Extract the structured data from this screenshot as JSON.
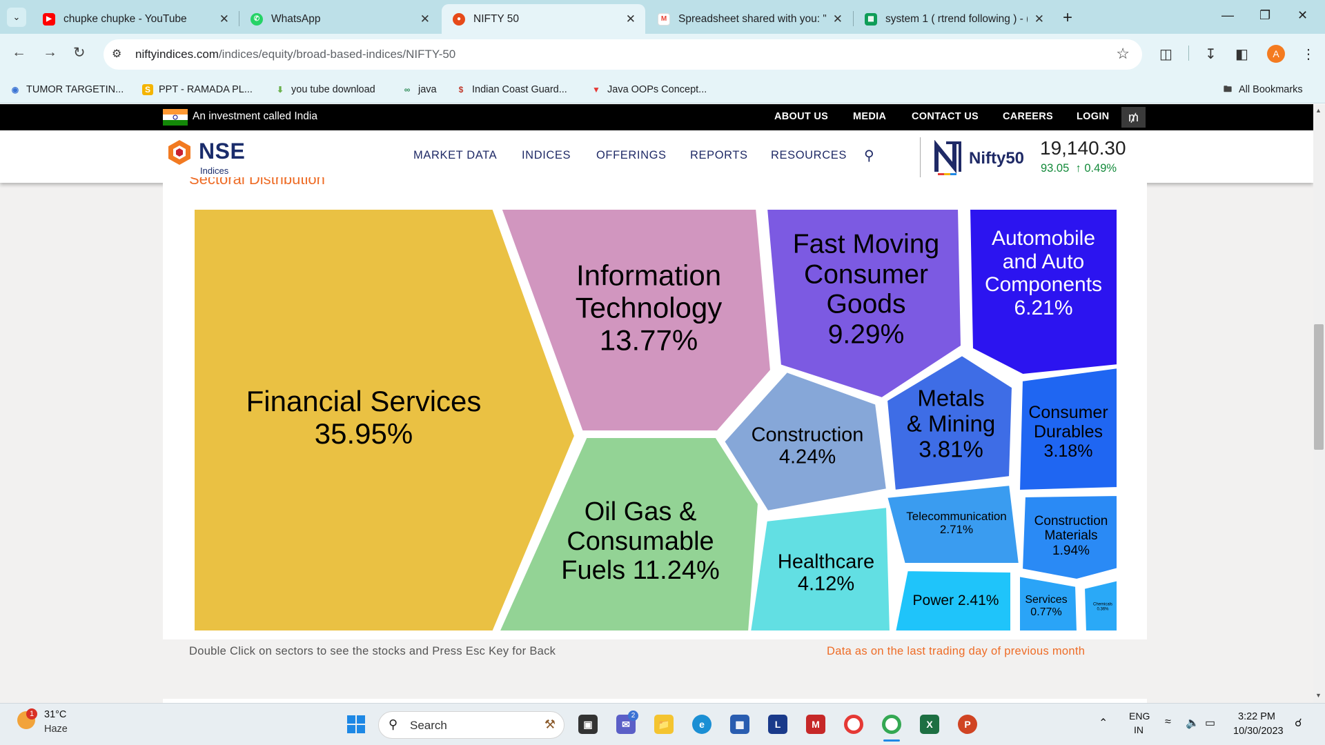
{
  "browser": {
    "tabs": [
      {
        "title": "chupke chupke - YouTube",
        "icon": "youtube-icon",
        "color": "#ff0000"
      },
      {
        "title": "WhatsApp",
        "icon": "whatsapp-icon",
        "color": "#25d366"
      },
      {
        "title": "NIFTY 50",
        "icon": "nse-icon",
        "color": "#e64a19",
        "active": true
      },
      {
        "title": "Spreadsheet shared with you: \"",
        "icon": "gmail-icon",
        "color": "#ea4335"
      },
      {
        "title": "system 1 ( rtrend following ) - (",
        "icon": "sheets-icon",
        "color": "#0f9d58"
      }
    ],
    "url_host": "niftyindices.com",
    "url_path": "/indices/equity/broad-based-indices/NIFTY-50",
    "avatar_letter": "A",
    "bookmarks": [
      {
        "label": "TUMOR TARGETIN...",
        "icon": "bookmark-icon"
      },
      {
        "label": "PPT - RAMADA PL...",
        "icon": "bookmark-icon"
      },
      {
        "label": "you tube download",
        "icon": "download-icon"
      },
      {
        "label": "java",
        "icon": "bookmark-icon"
      },
      {
        "label": "Indian Coast Guard...",
        "icon": "bookmark-icon"
      },
      {
        "label": "Java OOPs Concept...",
        "icon": "bookmark-icon"
      }
    ],
    "all_bookmarks": "All Bookmarks"
  },
  "site": {
    "tagline": "An investment called India",
    "top_links": [
      "ABOUT US",
      "MEDIA",
      "CONTACT US",
      "CAREERS",
      "LOGIN"
    ],
    "brand": "NSE",
    "brand_sub": "Indices",
    "nav": [
      "MARKET DATA",
      "INDICES",
      "OFFERINGS",
      "REPORTS",
      "RESOURCES"
    ],
    "index_name": "Nifty50",
    "index_value": "19,140.30",
    "index_change": "93.05",
    "index_change_pct": "0.49%",
    "section_title": "Sectoral Distribution",
    "note_left": "Double Click on sectors to see the stocks and Press Esc Key for Back",
    "note_right": "Data as on the last trading day of previous month"
  },
  "chart_data": {
    "type": "treemap",
    "sectors": [
      {
        "name": "Financial Services",
        "value": 35.95,
        "label": "35.95%",
        "color": "#eac143"
      },
      {
        "name": "Information Technology",
        "value": 13.77,
        "label": "13.77%",
        "color": "#d196bf"
      },
      {
        "name": "Oil Gas & Consumable Fuels",
        "value": 11.24,
        "label": "11.24%",
        "color": "#93d395"
      },
      {
        "name": "Fast Moving Consumer Goods",
        "value": 9.29,
        "label": "9.29%",
        "color": "#7c5ae2"
      },
      {
        "name": "Automobile and Auto Components",
        "value": 6.21,
        "label": "6.21%",
        "color": "#2c14f0"
      },
      {
        "name": "Construction",
        "value": 4.24,
        "label": "4.24%",
        "color": "#86a7d8"
      },
      {
        "name": "Healthcare",
        "value": 4.12,
        "label": "4.12%",
        "color": "#62dfe3"
      },
      {
        "name": "Metals & Mining",
        "value": 3.81,
        "label": "3.81%",
        "color": "#3e6de6"
      },
      {
        "name": "Consumer Durables",
        "value": 3.18,
        "label": "3.18%",
        "color": "#1f66f2"
      },
      {
        "name": "Telecommunication",
        "value": 2.71,
        "label": "2.71%",
        "color": "#3a9cf0"
      },
      {
        "name": "Power",
        "value": 2.41,
        "label": "2.41%",
        "color": "#1fc4fa"
      },
      {
        "name": "Construction Materials",
        "value": 1.94,
        "label": "1.94%",
        "color": "#2a8af5"
      },
      {
        "name": "Services",
        "value": 0.77,
        "label": "0.77%",
        "color": "#2aa4f7"
      },
      {
        "name": "Chemicals",
        "value": 0.36,
        "label": "0.36%",
        "color": "#2aa9f7"
      }
    ]
  },
  "taskbar": {
    "temp": "31°C",
    "weather": "Haze",
    "weather_badge": "1",
    "search": "Search",
    "lang1": "ENG",
    "lang2": "IN",
    "time": "3:22 PM",
    "date": "10/30/2023",
    "teams_badge": "2"
  }
}
